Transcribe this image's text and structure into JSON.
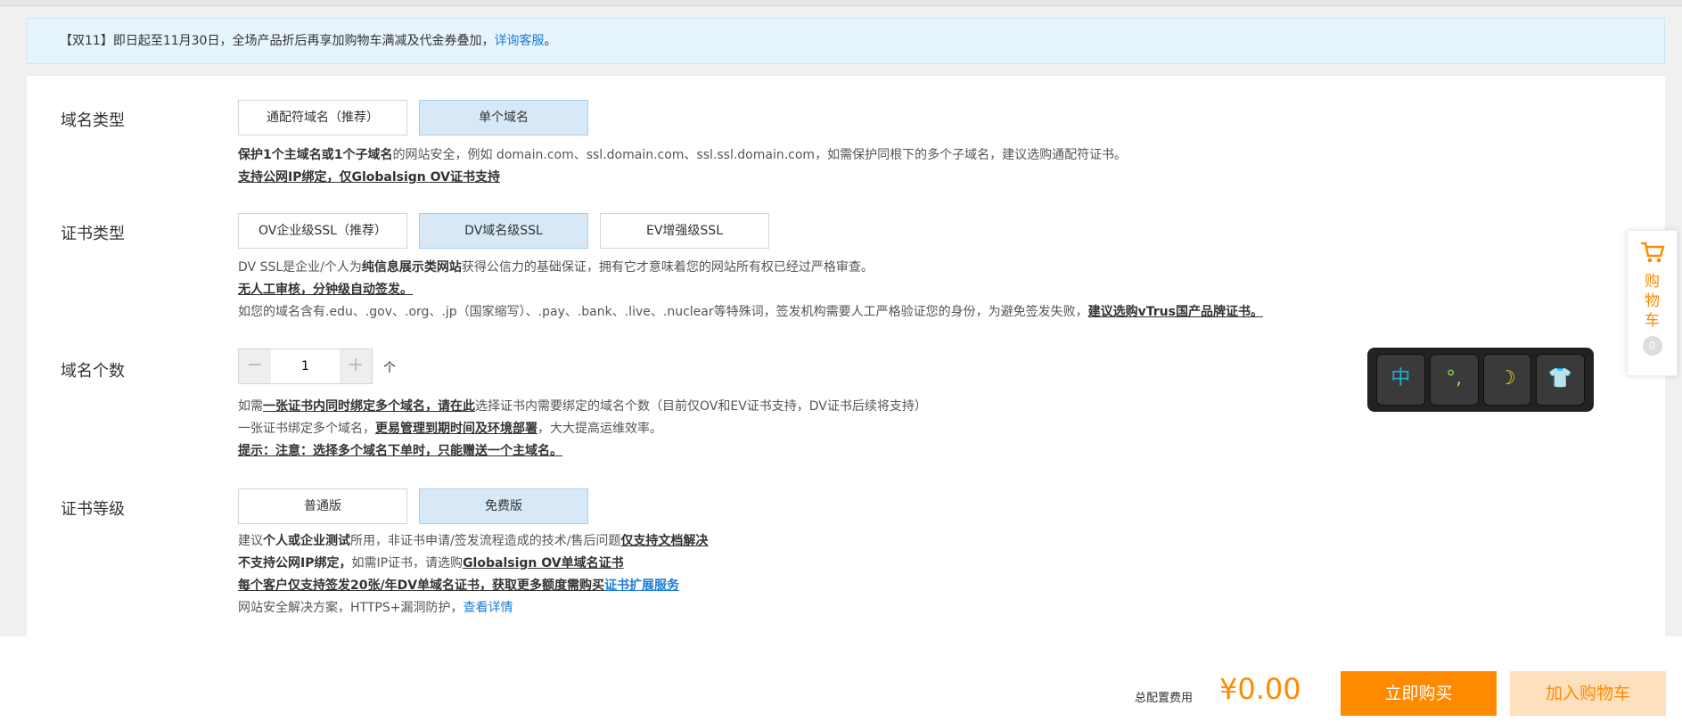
{
  "notice": {
    "text": "【双11】即日起至11月30日，全场产品折后再享加购物车满减及代金券叠加，",
    "link": "详询客服",
    "tail": "。"
  },
  "domain_type": {
    "label": "域名类型",
    "options": [
      "通配符域名（推荐）",
      "单个域名"
    ],
    "selected": "单个域名",
    "desc1_bold": "保护1个主域名或1个子域名",
    "desc1_rest": "的网站安全，例如 domain.com、ssl.domain.com、ssl.ssl.domain.com，如需保护同根下的多个子域名，建议选购通配符证书。",
    "desc2": "支持公网IP绑定，仅Globalsign OV证书支持"
  },
  "cert_type": {
    "label": "证书类型",
    "options": [
      "OV企业级SSL（推荐）",
      "DV域名级SSL",
      "EV增强级SSL"
    ],
    "selected": "DV域名级SSL",
    "desc1_a": "DV SSL是企业/个人为",
    "desc1_bold": "纯信息展示类网站",
    "desc1_b": "获得公信力的基础保证，拥有它才意味着您的网站所有权已经过严格审查。",
    "desc2": "无人工审核，分钟级自动签发。",
    "desc3_a": "如您的域名含有.edu、.gov、.org、.jp（国家缩写）、.pay、.bank、.live、.nuclear等特殊词，签发机构需要人工严格验证您的身份，为避免签发失败，",
    "desc3_link": "建议选购vTrus国产品牌证书。"
  },
  "domain_count": {
    "label": "域名个数",
    "minus": "−",
    "value": "1",
    "plus": "+",
    "unit": "个",
    "desc1_a": "如需",
    "desc1_link": "一张证书内同时绑定多个域名，请在此",
    "desc1_b": "选择证书内需要绑定的域名个数（目前仅OV和EV证书支持，DV证书后续将支持）",
    "desc2_a": "一张证书绑定多个域名，",
    "desc2_link": "更易管理到期时间及环境部署",
    "desc2_b": "，大大提高运维效率。",
    "desc3": "提示：注意：选择多个域名下单时，只能赠送一个主域名。"
  },
  "cert_level": {
    "label": "证书等级",
    "options": [
      "普通版",
      "免费版"
    ],
    "selected": "免费版",
    "desc1_a": "建议",
    "desc1_bold": "个人或企业测试",
    "desc1_b": "所用，非证书申请/签发流程造成的技术/售后问题",
    "desc1_link": "仅支持文档解决",
    "desc2_bold": "不支持公网IP绑定，",
    "desc2_a": "如需IP证书，请选购",
    "desc2_link": "Globalsign OV单域名证书",
    "desc3_link": "每个客户仅支持签发20张/年DV单域名证书，获取更多额度需购买",
    "desc3_blue": "证书扩展服务",
    "desc4_a": "网站安全解决方案，HTTPS+漏洞防护，",
    "desc4_link": "查看详情"
  },
  "footer": {
    "total_label": "总配置费用",
    "price": "¥0.00",
    "buy": "立即购买",
    "add_cart": "加入购物车"
  },
  "float_cart": {
    "label": "购物车",
    "count": "0"
  },
  "ime_toolbar": {
    "keys": [
      "中",
      "°,",
      "☽",
      "👕"
    ]
  }
}
